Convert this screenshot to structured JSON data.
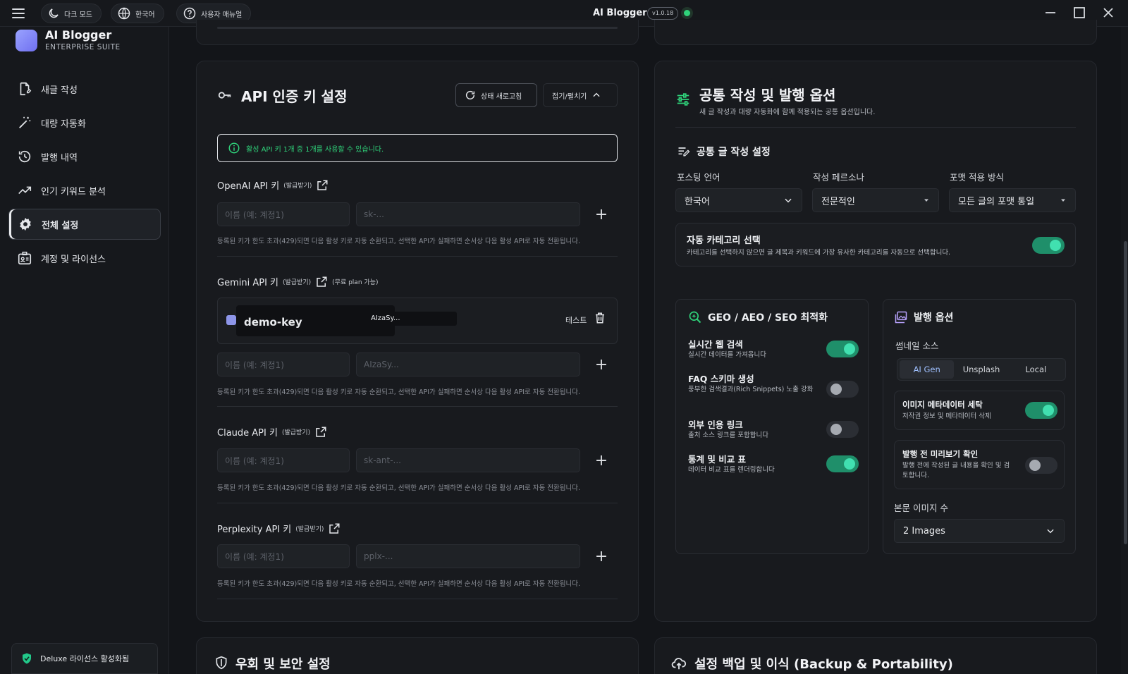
{
  "titlebar": {
    "dark_mode": "다크 모드",
    "language": "한국어",
    "manual": "사용자 매뉴얼",
    "app_title": "AI Blogger",
    "version": "v1.0.18"
  },
  "sidebar": {
    "brand": "AI Blogger",
    "brand_sub": "ENTERPRISE SUITE",
    "items": [
      {
        "label": "새글 작성",
        "icon": "new-doc-icon"
      },
      {
        "label": "대량 자동화",
        "icon": "magic-wand-icon"
      },
      {
        "label": "발행 내역",
        "icon": "history-icon"
      },
      {
        "label": "인기 키워드 분석",
        "icon": "trend-icon"
      },
      {
        "label": "전체 설정",
        "icon": "gear-icon"
      },
      {
        "label": "계정 및 라이선스",
        "icon": "id-badge-icon"
      }
    ],
    "license": "Deluxe 라이선스 활성화됨"
  },
  "api": {
    "title": "API 인증 키 설정",
    "refresh": "상태 새로고침",
    "collapse": "접기/펼치기",
    "info": "활성 API 키 1개 중 1개를 사용할 수 있습니다.",
    "issue_link": "(발급받기)",
    "free_plan": "(무료 plan 가능)",
    "name_placeholder": "이름 (예: 계정1)",
    "help": "등록된 키가 한도 초과(429)되면 다음 활성 키로 자동 순환되고, 선택한 API가 실패하면 순서상 다음 활성 API로 자동 전환됩니다.",
    "providers": [
      {
        "label": "OpenAI API 키",
        "key_placeholder": "sk-..."
      },
      {
        "label": "Gemini API 키",
        "key_placeholder": "AIzaSy..."
      },
      {
        "label": "Claude API 키",
        "key_placeholder": "sk-ant-..."
      },
      {
        "label": "Perplexity API 키",
        "key_placeholder": "pplx-..."
      }
    ],
    "saved_key": {
      "name": "demo-key",
      "masked": "AIzaSy...",
      "test": "테스트"
    }
  },
  "common": {
    "title": "공통 작성 및 발행 옵션",
    "subtitle": "새 글 작성과 대량 자동화에 함께 적용되는 공통 옵션입니다.",
    "writing_title": "공통 글 작성 설정",
    "fields": [
      {
        "label": "포스팅 언어",
        "value": "한국어"
      },
      {
        "label": "작성 페르소나",
        "value": "전문적인"
      },
      {
        "label": "포맷 적용 방식",
        "value": "모든 글의 포맷 통일"
      }
    ],
    "auto_category": {
      "title": "자동 카테고리 선택",
      "desc": "카테고리를 선택하지 않으면 글 제목과 키워드에 가장 유사한 카테고리를 자동으로 선택합니다.",
      "on": true
    }
  },
  "geo": {
    "title": "GEO / AEO / SEO 최적화",
    "options": [
      {
        "title": "실시간 웹 검색",
        "desc": "실시간 데이터를 가져옵니다",
        "on": true
      },
      {
        "title": "FAQ 스키마 생성",
        "desc": "풍부한 검색결과(Rich Snippets) 노출 강화",
        "on": false
      },
      {
        "title": "외부 인용 링크",
        "desc": "출처 소스 링크를 포함합니다",
        "on": false
      },
      {
        "title": "통계 및 비교 표",
        "desc": "데이터 비교 표를 렌더링합니다",
        "on": true
      }
    ]
  },
  "publish": {
    "title": "발행 옵션",
    "thumb_label": "썸네일 소스",
    "thumb_options": [
      "AI Gen",
      "Unsplash",
      "Local"
    ],
    "thumb_selected": "AI Gen",
    "metadata": {
      "title": "이미지 메타데이터 세탁",
      "desc": "저작권 정보 및 메타데이터 삭제",
      "on": true
    },
    "preview": {
      "title": "발행 전 미리보기 확인",
      "desc": "발행 전에 작성된 글 내용을 확인 및 검토합니다.",
      "on": false
    },
    "image_count_label": "본문 이미지 수",
    "image_count": "2 Images"
  },
  "bottom": {
    "security_title": "우회 및 보안 설정",
    "backup_title": "설정 백업 및 이식 (Backup & Portability)"
  }
}
